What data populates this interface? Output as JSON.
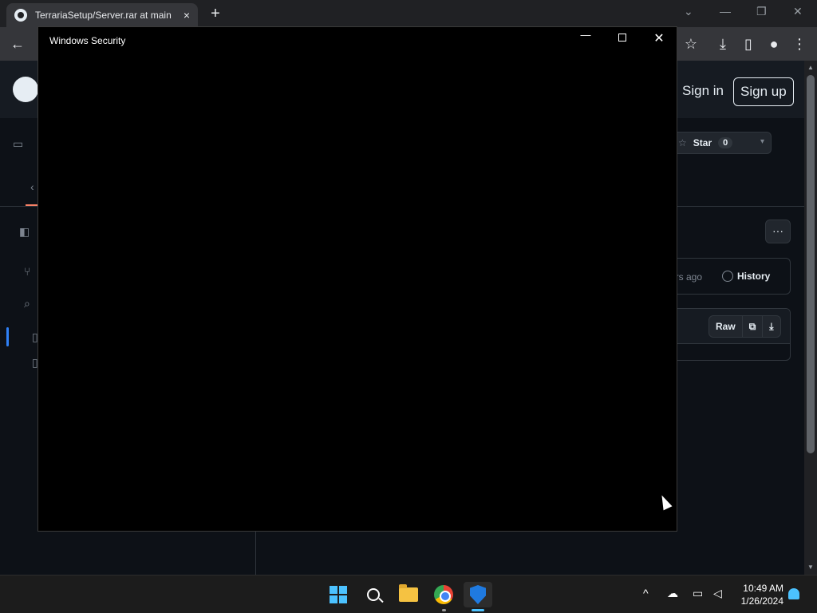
{
  "browser": {
    "tab_title": "TerrariaSetup/Server.rar at main",
    "tab_close": "×",
    "new_tab": "+",
    "window_controls": {
      "minimize": "—",
      "restore": "❐",
      "close": "✕",
      "tab_search": "⌄"
    },
    "toolbar": {
      "back": "←",
      "star": "☆",
      "download": "⤓",
      "sidepanel": "▯",
      "profile": "●",
      "menu": "⋮"
    }
  },
  "github": {
    "sign_in": "Sign in",
    "sign_up": "Sign up",
    "star_label": "Star",
    "star_count": "0",
    "commit_ago": "urs ago",
    "history": "History",
    "raw": "Raw",
    "more": "···",
    "copy_icon": "⧉",
    "download_icon": "⤓"
  },
  "dialog": {
    "title": "Windows Security",
    "minimize": "—",
    "close": "✕"
  },
  "taskbar": {
    "time": "10:49 AM",
    "date": "1/26/2024",
    "tray_chevron": "^",
    "accent": "#4cc2ff"
  }
}
